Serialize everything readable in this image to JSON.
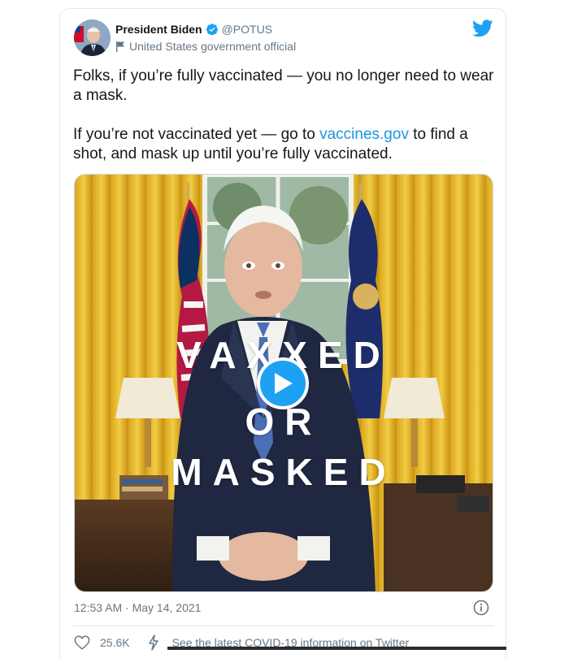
{
  "author": {
    "name": "President Biden",
    "handle": "@POTUS",
    "label": "United States government official"
  },
  "tweet": {
    "line1": "Folks, if you’re fully vaccinated — you no longer need to wear a mask.",
    "line2_before": "If you’re not vaccinated yet — go to ",
    "line2_link": "vaccines.gov",
    "line2_after": " to find a shot, and mask up until you’re fully vaccinated."
  },
  "media": {
    "overlay_line1": "VAXXED",
    "overlay_line2": "OR",
    "overlay_line3": "MASKED"
  },
  "meta": {
    "timestamp": "12:53 AM · May 14, 2021",
    "likes": "25.6K",
    "covid_info": "See the latest COVID-19 information on Twitter"
  },
  "icons": [
    "verified-badge-icon",
    "flag-icon",
    "twitter-bird-icon",
    "play-icon",
    "info-icon",
    "heart-icon",
    "covid-bolt-icon"
  ],
  "colors": {
    "accent": "#1da1f2",
    "link": "#1b95e0",
    "secondary_text": "#657786",
    "border": "#e1e8ed"
  }
}
